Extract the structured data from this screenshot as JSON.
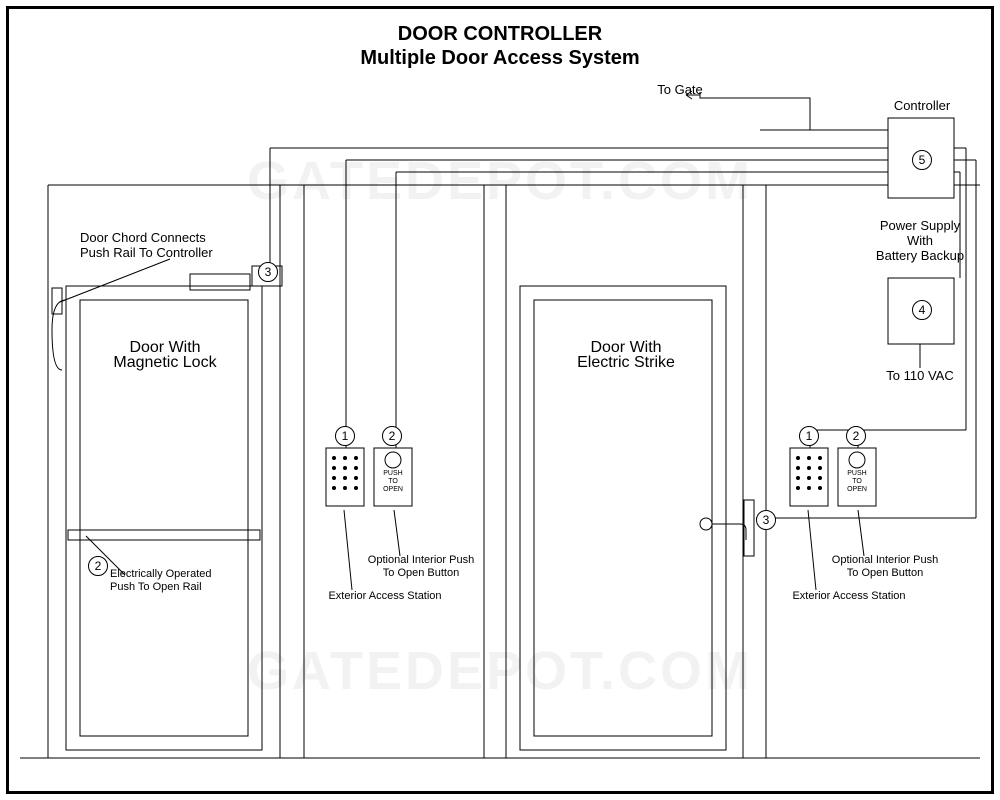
{
  "title_line1": "DOOR CONTROLLER",
  "title_line2": "Multiple Door Access System",
  "watermark": "GATEDEPOT.COM",
  "labels": {
    "to_gate": "To Gate",
    "controller": "Controller",
    "power_supply": "Power Supply\nWith\nBattery Backup",
    "to_110": "To 110 VAC",
    "door_chord": "Door Chord Connects\nPush Rail To Controller",
    "door_maglock": "Door With\nMagnetic Lock",
    "door_strike": "Door With\nElectric Strike",
    "push_rail": "Electrically Operated\nPush To Open Rail",
    "push_button_label": "PUSH\nTO\nOPEN",
    "opt_push": "Optional Interior Push\nTo Open Button",
    "ext_station": "Exterior Access Station"
  },
  "callouts": {
    "one": "1",
    "two": "2",
    "three": "3",
    "four": "4",
    "five": "5"
  }
}
